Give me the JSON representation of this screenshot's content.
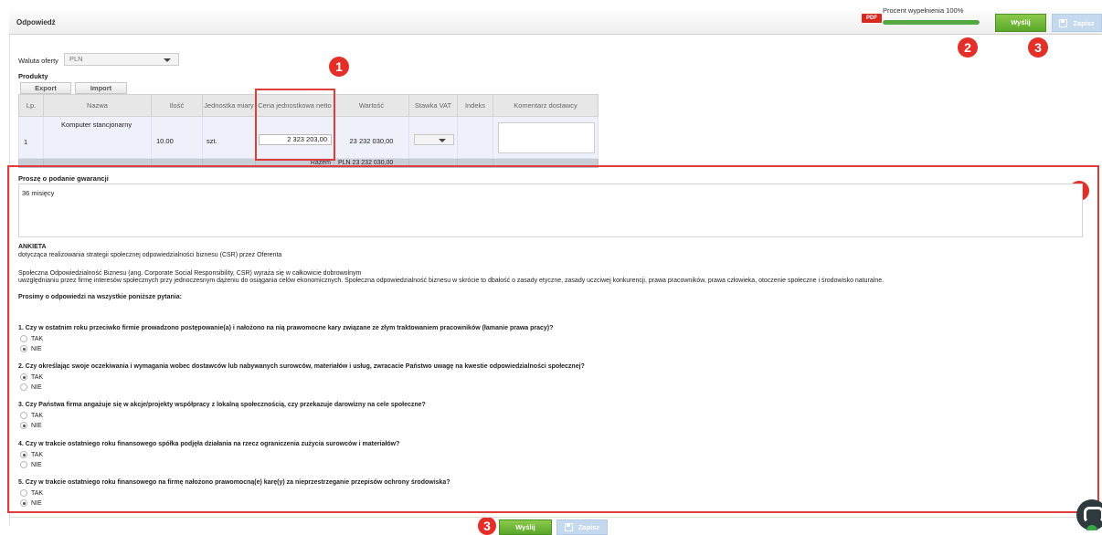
{
  "header": {
    "title": "Odpowiedź",
    "pdf_label": "PDF",
    "progress_label": "Procent wypełnienia 100%",
    "progress_fraction": 1.0,
    "send_label": "Wyślij",
    "save_label": "Zapisz"
  },
  "currency": {
    "label": "Waluta oferty",
    "value": "PLN"
  },
  "products": {
    "label": "Produkty",
    "export_label": "Export",
    "import_label": "Import",
    "columns": [
      "Lp.",
      "Nazwa",
      "Ilość",
      "Jednostka miary",
      "Cena jednostkowa netto",
      "Wartość",
      "Stawka VAT",
      "Indeks",
      "Komentarz dostawcy"
    ],
    "rows": [
      {
        "lp": "1",
        "name": "Komputer stancjonarny",
        "qty": "10.00",
        "unit": "szt.",
        "price": "2 323 203,00",
        "value": "23 232 030,00",
        "vat": "",
        "index": "",
        "comment": ""
      }
    ],
    "sum_label": "Razem",
    "sum_value": "PLN 23 232 030,00"
  },
  "annotations": [
    "1",
    "1",
    "2",
    "3",
    "3"
  ],
  "warranty": {
    "label": "Proszę o podanie gwarancji",
    "value": "36 misięcy"
  },
  "survey": {
    "title": "ANKIETA",
    "subtitle": "dotycząca realizowania strategii społecznej odpowiedzialności biznesu (CSR) przez Oferenta",
    "para1": "Społeczna Odpowiedzialność Biznesu (ang. Corporate Social Responsibility, CSR) wyraża się w całkowicie dobrowolnym",
    "para2": "uwzględnianiu przez firmę interesów społecznych przy jednoczesnym dążeniu do osiągania celów ekonomicznych. Społeczna odpowiedzialność biznesu w skrócie to dbałość o zasady etyczne, zasady uczciwej konkurencji, prawa pracowników, prawa człowieka, otoczenie społeczne i środowisko naturalne.",
    "prompt": "Prosimy o odpowiedzi na wszystkie poniższe pytania:",
    "yes_label": "TAK",
    "no_label": "NIE",
    "questions": [
      {
        "text": "1. Czy w ostatnim roku przeciwko firmie prowadzono postępowanie(a) i nałożono na nią prawomocne kary związane ze złym traktowaniem pracowników (łamanie prawa pracy)?",
        "answer": "NIE"
      },
      {
        "text": "2. Czy określając swoje oczekiwania i wymagania wobec dostawców lub nabywanych surowców, materiałów i usług, zwracacie Państwo uwagę na kwestie odpowiedzialności społecznej?",
        "answer": "TAK"
      },
      {
        "text": "3. Czy Państwa firma angażuje się w akcje/projekty współpracy z lokalną społecznością, czy przekazuje darowizny na cele społeczne?",
        "answer": "NIE"
      },
      {
        "text": "4. Czy w trakcie ostatniego roku finansowego spółka podjęła działania na rzecz ograniczenia zużycia surowców i materiałów?",
        "answer": "TAK"
      },
      {
        "text": "5. Czy w trakcie ostatniego roku finansowego na firmę nałożono prawomocną(e) karę(y) za nieprzestrzeganie przepisów ochrony środowiska?",
        "answer": "NIE"
      }
    ]
  }
}
